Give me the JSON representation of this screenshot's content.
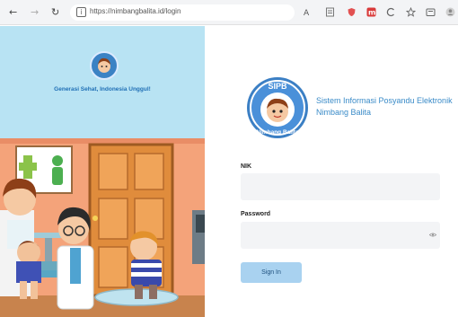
{
  "browser": {
    "url": "https://nimbangbalita.id/login",
    "back_icon": "back-arrow-icon",
    "forward_icon": "forward-arrow-icon",
    "reload_icon": "reload-icon"
  },
  "left": {
    "tagline": "Generasi Sehat, Indonesia Unggul!"
  },
  "brand": {
    "logo_top_text": "SIPB",
    "logo_bottom_text": "Nimbang Balita",
    "title_line1": "Sistem Informasi Posyandu Elektronik",
    "title_line2": "Nimbang Balita"
  },
  "form": {
    "nik_label": "NIK",
    "nik_value": "",
    "password_label": "Password",
    "password_value": "",
    "submit_label": "Sign In"
  },
  "colors": {
    "accent": "#3a8bc8",
    "panel_bg": "#b8e3f3",
    "button_bg": "#a9d2f0"
  }
}
